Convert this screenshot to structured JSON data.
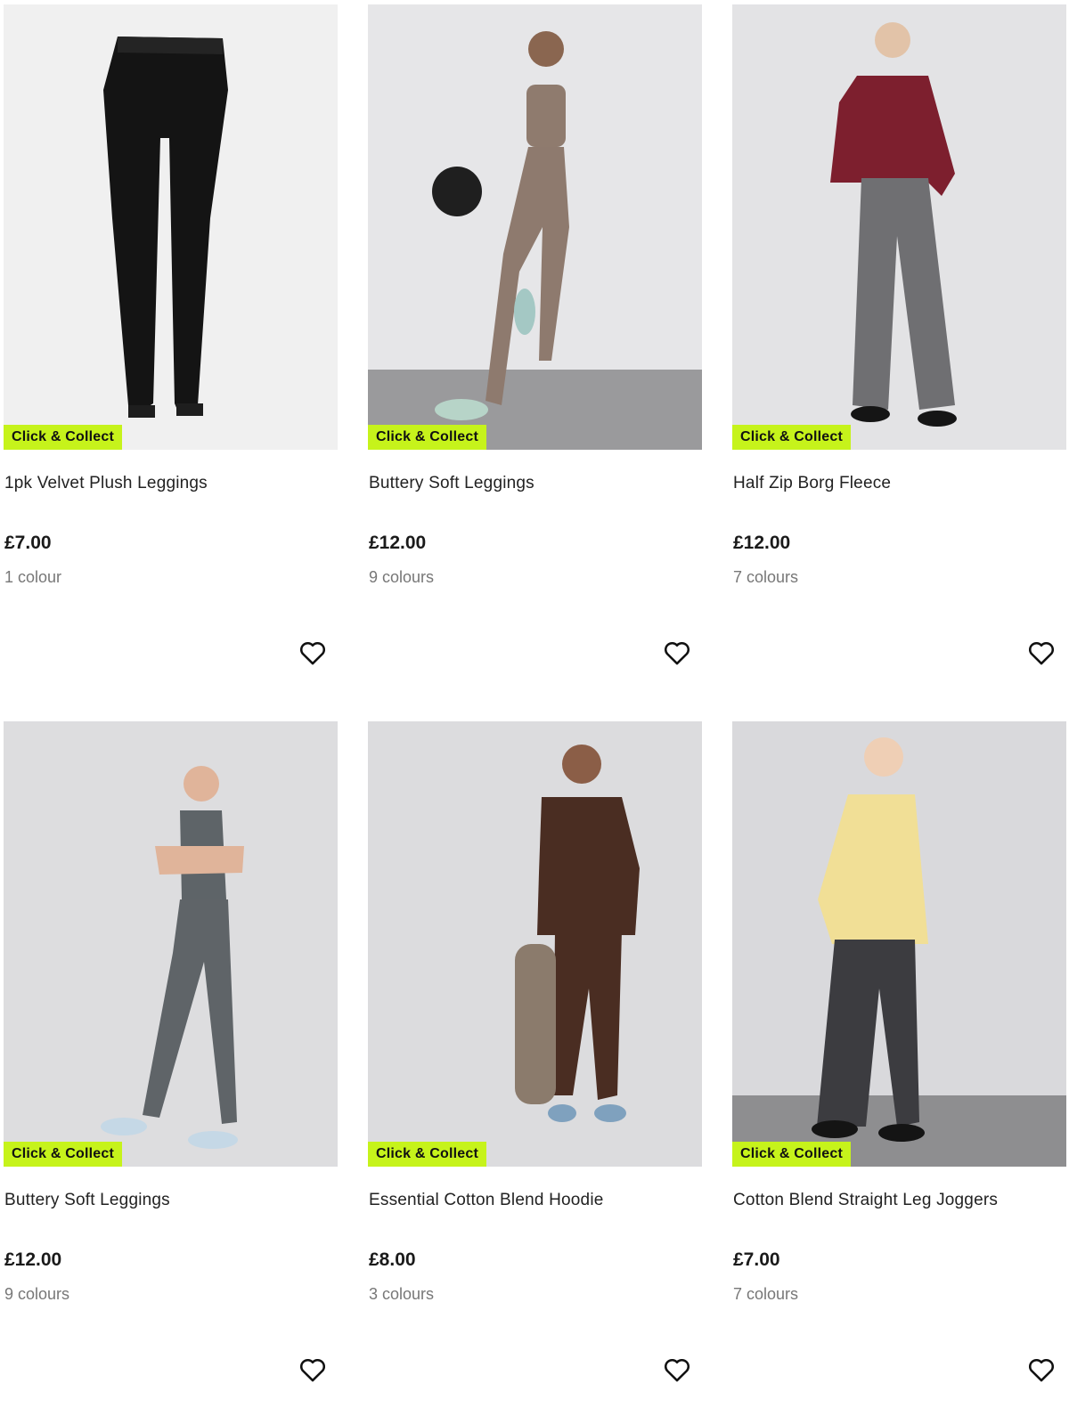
{
  "badge_color": "#c6f31b",
  "products": [
    {
      "name": "1pk Velvet Plush Leggings",
      "price": "£7.00",
      "colours": "1 colour",
      "badge": "Click & Collect",
      "wishlist_icon": "heart-outline-icon",
      "image_type": "flat-leggings"
    },
    {
      "name": "Buttery Soft Leggings",
      "price": "£12.00",
      "colours": "9 colours",
      "badge": "Click & Collect",
      "wishlist_icon": "heart-outline-icon",
      "image_type": "model-leggings-ball"
    },
    {
      "name": "Half Zip Borg Fleece",
      "price": "£12.00",
      "colours": "7 colours",
      "badge": "Click & Collect",
      "wishlist_icon": "heart-outline-icon",
      "image_type": "model-fleece"
    },
    {
      "name": "Buttery Soft Leggings",
      "price": "£12.00",
      "colours": "9 colours",
      "badge": "Click & Collect",
      "wishlist_icon": "heart-outline-icon",
      "image_type": "model-leggings-grey"
    },
    {
      "name": "Essential Cotton Blend Hoodie",
      "price": "£8.00",
      "colours": "3 colours",
      "badge": "Click & Collect",
      "wishlist_icon": "heart-outline-icon",
      "image_type": "model-hoodie"
    },
    {
      "name": "Cotton Blend Straight Leg Joggers",
      "price": "£7.00",
      "colours": "7 colours",
      "badge": "Click & Collect",
      "wishlist_icon": "heart-outline-icon",
      "image_type": "model-joggers"
    }
  ]
}
